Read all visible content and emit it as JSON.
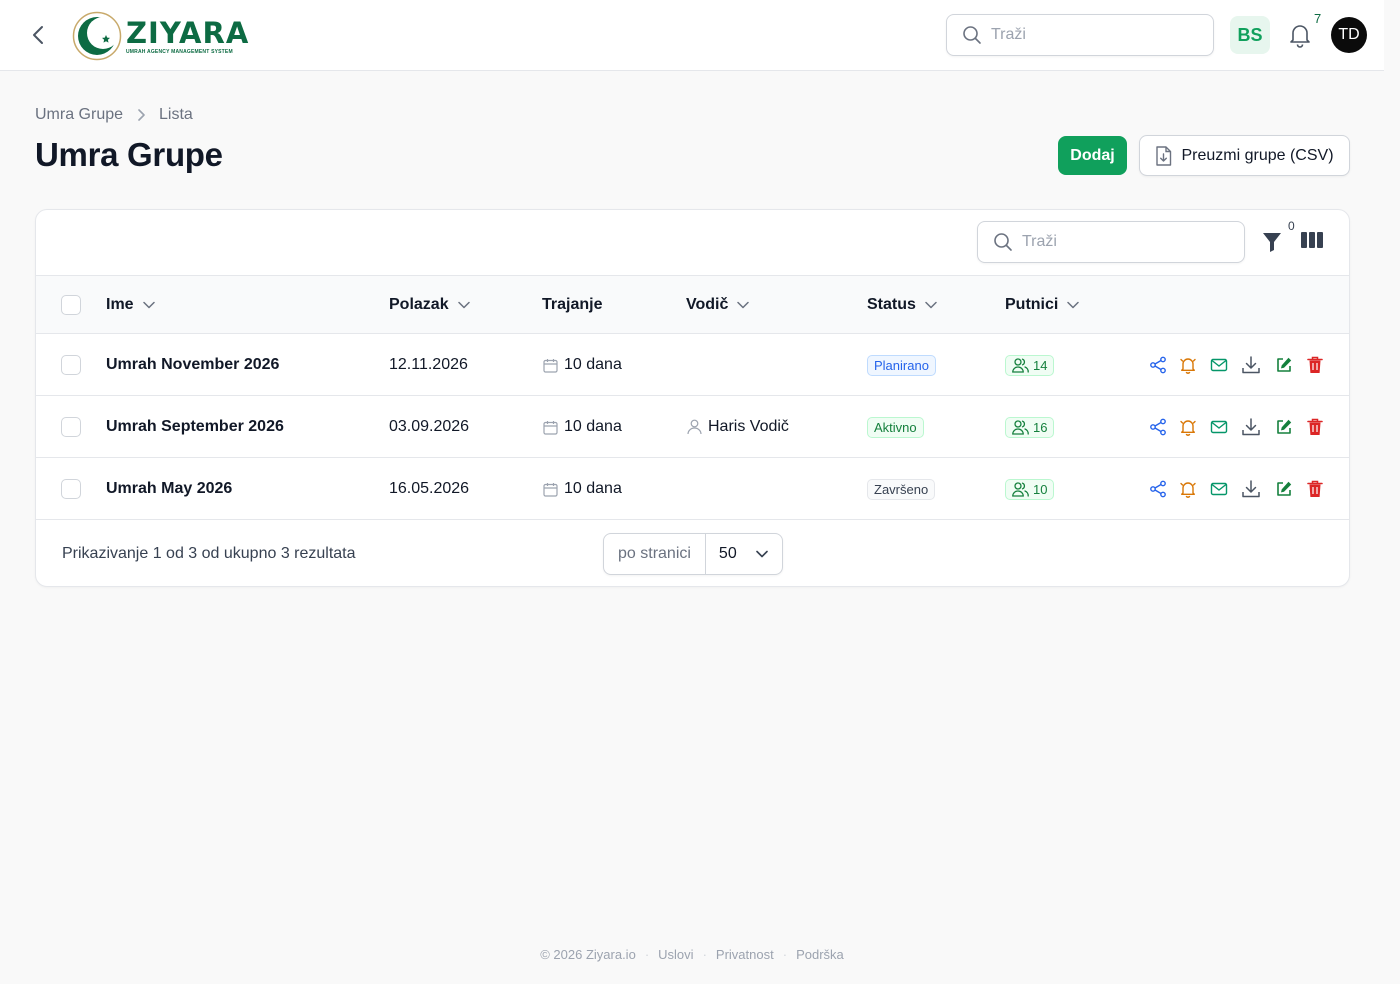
{
  "topbar": {
    "logo_title": "ZIYARA",
    "logo_subtitle": "UMRAH AGENCY MANAGEMENT SYSTEM",
    "search_placeholder": "Traži",
    "language": "BS",
    "notification_count": "7",
    "avatar_initials": "TD"
  },
  "breadcrumb": {
    "parent": "Umra Grupe",
    "current": "Lista"
  },
  "page": {
    "title": "Umra Grupe",
    "add_label": "Dodaj",
    "csv_label": "Preuzmi grupe (CSV)"
  },
  "table": {
    "search_placeholder": "Traži",
    "filter_count": "0",
    "columns": {
      "name": "Ime",
      "departure": "Polazak",
      "duration": "Trajanje",
      "guide": "Vodič",
      "status": "Status",
      "passengers": "Putnici"
    },
    "rows": [
      {
        "name": "Umrah November 2026",
        "departure": "12.11.2026",
        "duration": "10 dana",
        "guide": "",
        "status": "Planirano",
        "status_kind": "planned",
        "passengers": "14"
      },
      {
        "name": "Umrah September 2026",
        "departure": "03.09.2026",
        "duration": "10 dana",
        "guide": "Haris Vodič",
        "status": "Aktivno",
        "status_kind": "active",
        "passengers": "16"
      },
      {
        "name": "Umrah May 2026",
        "departure": "16.05.2026",
        "duration": "10 dana",
        "guide": "",
        "status": "Završeno",
        "status_kind": "done",
        "passengers": "10"
      }
    ],
    "result_text": "Prikazivanje 1 od 3 od ukupno 3 rezultata",
    "per_page_label": "po stranici",
    "per_page_value": "50"
  },
  "footer": {
    "copyright": "© 2026 Ziyara.io",
    "terms": "Uslovi",
    "privacy": "Privatnost",
    "support": "Podrška"
  },
  "colors": {
    "brand": "#0d6b43",
    "primary_button": "#10a05c",
    "action_share": "#2563eb",
    "action_notify": "#d97706",
    "action_email": "#059669",
    "action_download": "#4b5563",
    "action_edit": "#15803d",
    "action_delete": "#dc2626"
  },
  "icons": [
    "back-chevron-icon",
    "search-icon",
    "bell-icon",
    "file-download-icon",
    "filter-icon",
    "columns-icon",
    "calendar-icon",
    "user-icon",
    "users-icon",
    "share-icon",
    "notify-bell-icon",
    "email-icon",
    "download-icon",
    "edit-icon",
    "trash-icon"
  ]
}
